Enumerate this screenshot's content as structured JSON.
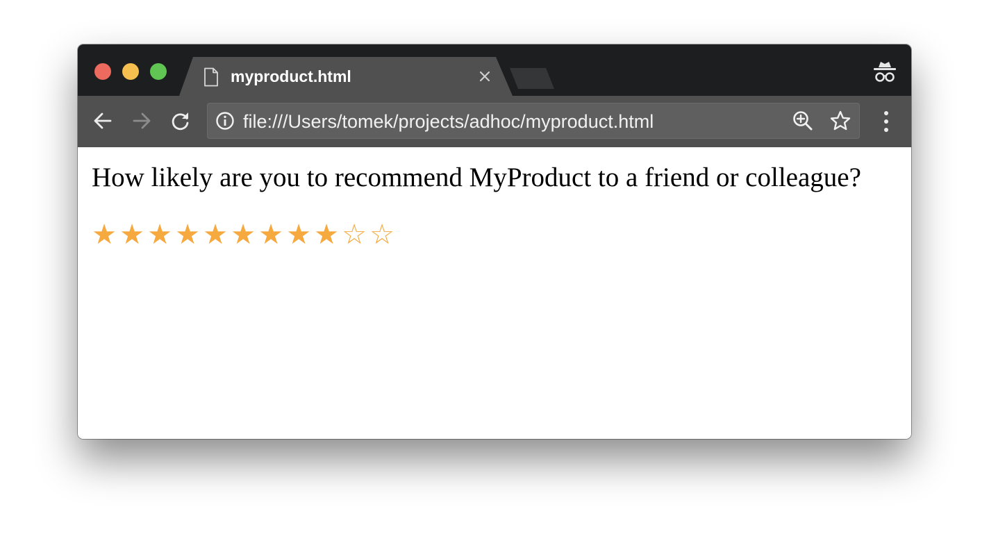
{
  "tab": {
    "title": "myproduct.html"
  },
  "address_bar": {
    "url": "file:///Users/tomek/projects/adhoc/myproduct.html"
  },
  "page": {
    "question": "How likely are you to recommend MyProduct to a friend or colleague?",
    "rating": {
      "value": 9,
      "max": 11,
      "filled_glyph": "★",
      "empty_glyph": "☆",
      "color": "#f5a93e"
    }
  },
  "colors": {
    "titlebar": "#1d1e20",
    "toolbar": "#505050",
    "omnibox": "#5f5f5f",
    "star_accent": "#f5a93e"
  },
  "icons": {
    "tab": "document-icon",
    "incognito": "incognito-icon",
    "back": "back-arrow-icon",
    "forward": "forward-arrow-icon",
    "reload": "reload-icon",
    "site_info": "info-icon",
    "zoom": "zoom-in-icon",
    "bookmark": "star-outline-icon",
    "menu": "kebab-menu-icon"
  }
}
